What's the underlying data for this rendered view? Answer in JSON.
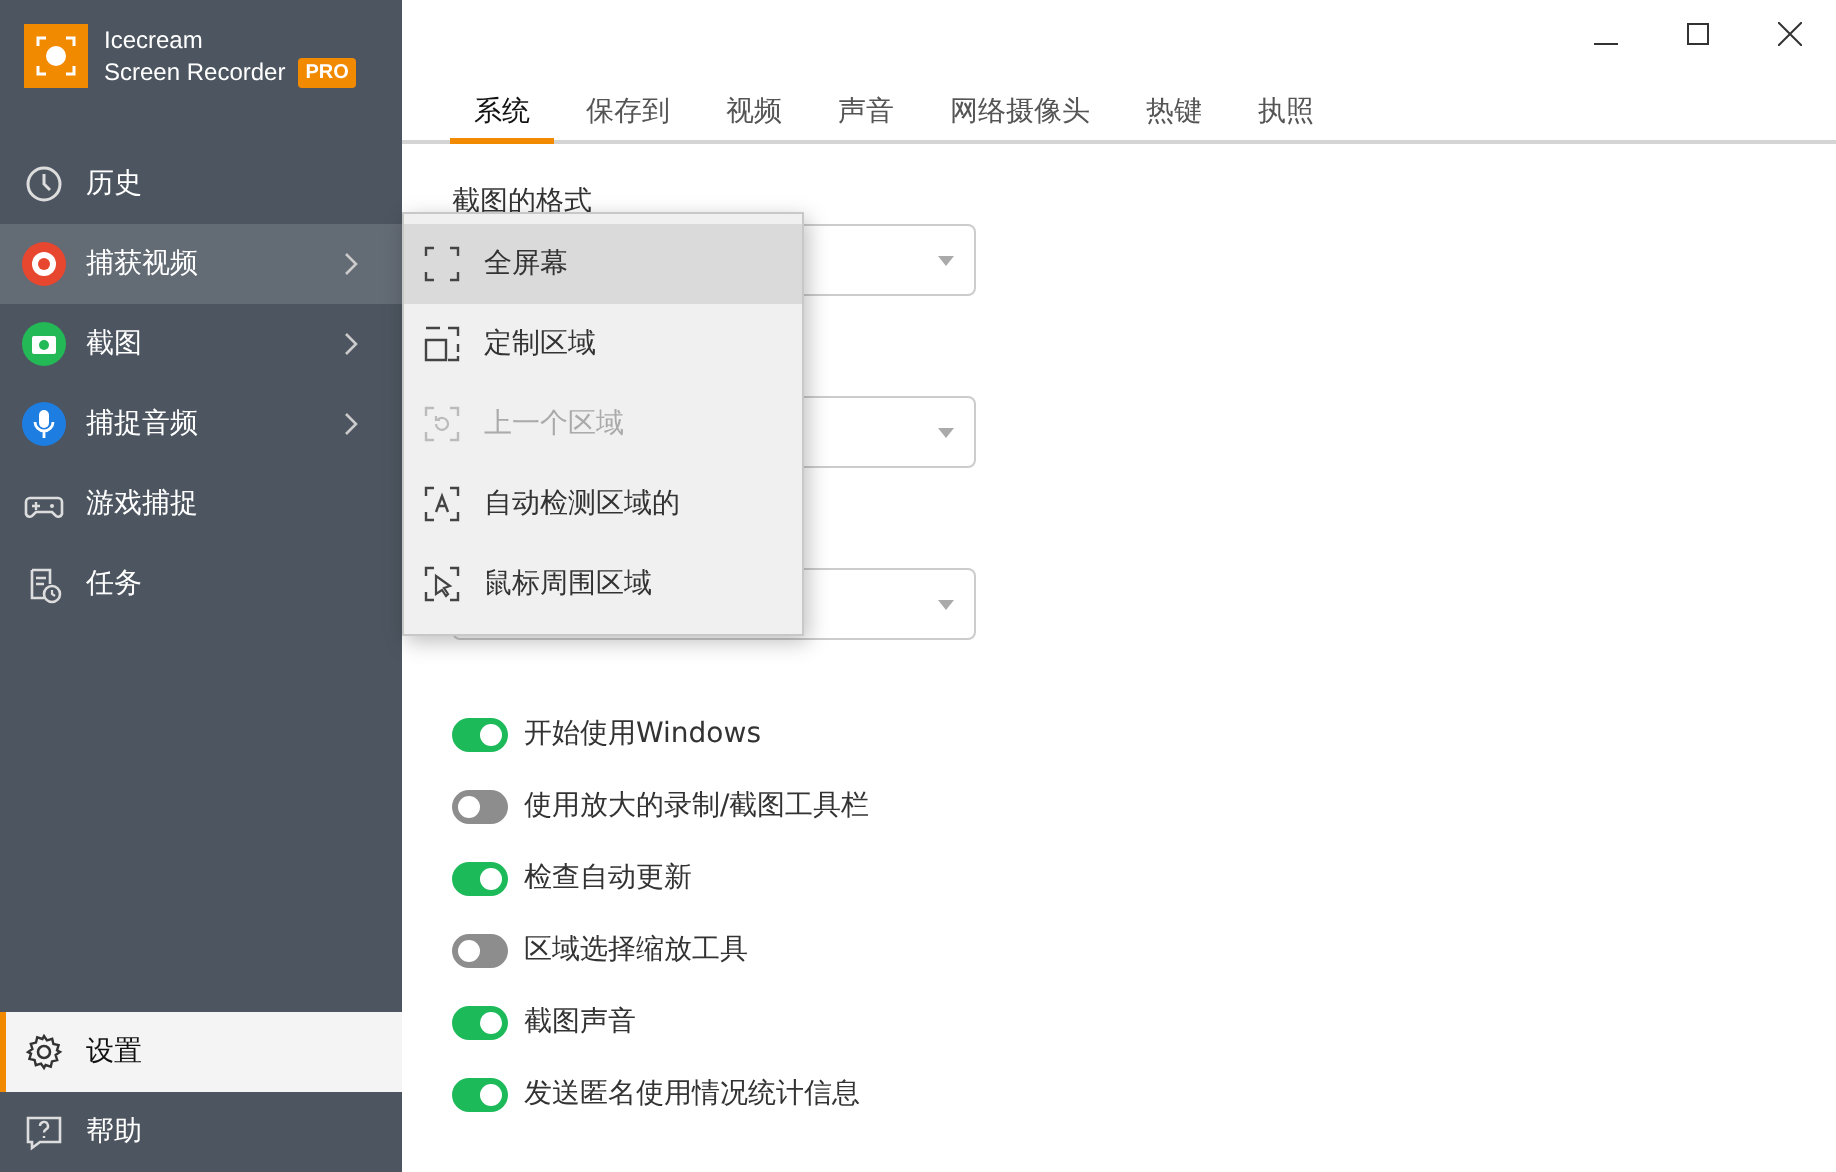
{
  "app": {
    "name": "Icecream",
    "subtitle": "Screen Recorder",
    "badge": "PRO"
  },
  "nav": [
    {
      "label": "历史",
      "kind": "clock",
      "selected": false,
      "submenu": false
    },
    {
      "label": "捕获视频",
      "kind": "record",
      "selected": true,
      "submenu": true
    },
    {
      "label": "截图",
      "kind": "camera",
      "selected": false,
      "submenu": true
    },
    {
      "label": "捕捉音频",
      "kind": "mic",
      "selected": false,
      "submenu": true
    },
    {
      "label": "游戏捕捉",
      "kind": "gamepad",
      "selected": false,
      "submenu": false
    },
    {
      "label": "任务",
      "kind": "tasks",
      "selected": false,
      "submenu": false
    }
  ],
  "bottom_nav": [
    {
      "label": "设置",
      "kind": "gear",
      "selected": true
    },
    {
      "label": "帮助",
      "kind": "help",
      "selected": false
    }
  ],
  "tabs": [
    {
      "label": "系统",
      "selected": true
    },
    {
      "label": "保存到",
      "selected": false
    },
    {
      "label": "视频",
      "selected": false
    },
    {
      "label": "声音",
      "selected": false
    },
    {
      "label": "网络摄像头",
      "selected": false
    },
    {
      "label": "热键",
      "selected": false
    },
    {
      "label": "执照",
      "selected": false
    }
  ],
  "form_label": "截图的格式",
  "toggles": [
    {
      "label": "开始使用Windows",
      "on": true
    },
    {
      "label": "使用放大的录制/截图工具栏",
      "on": false
    },
    {
      "label": "检查自动更新",
      "on": true
    },
    {
      "label": "区域选择缩放工具",
      "on": false
    },
    {
      "label": "截图声音",
      "on": true
    },
    {
      "label": "发送匿名使用情况统计信息",
      "on": true
    }
  ],
  "menu": [
    {
      "label": "全屏幕",
      "kind": "fullscreen",
      "selected": true,
      "disabled": false
    },
    {
      "label": "定制区域",
      "kind": "custom",
      "selected": false,
      "disabled": false
    },
    {
      "label": "上一个区域",
      "kind": "previous",
      "selected": false,
      "disabled": true
    },
    {
      "label": "自动检测区域的",
      "kind": "auto",
      "selected": false,
      "disabled": false
    },
    {
      "label": "鼠标周围区域",
      "kind": "cursor",
      "selected": false,
      "disabled": false
    }
  ]
}
